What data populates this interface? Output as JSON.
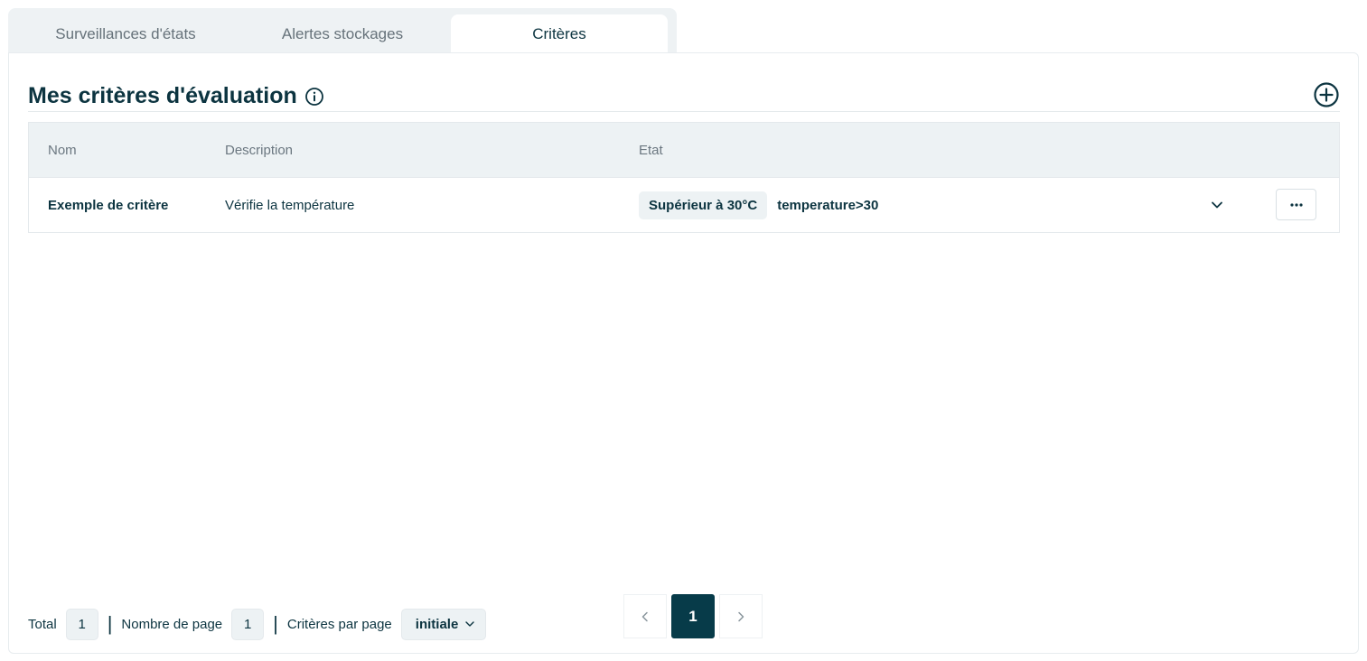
{
  "tabs": [
    {
      "label": "Surveillances d'états",
      "active": false
    },
    {
      "label": "Alertes stockages",
      "active": false
    },
    {
      "label": "Critères",
      "active": true
    }
  ],
  "section": {
    "title": "Mes critères d'évaluation",
    "info_icon": "info-icon",
    "add_icon": "plus-circle-icon"
  },
  "table": {
    "headers": {
      "name": "Nom",
      "description": "Description",
      "state": "Etat"
    },
    "rows": [
      {
        "name": "Exemple de critère",
        "description": "Vérifie la température",
        "state_chip": "Supérieur à 30°C",
        "expression": "temperature>30"
      }
    ]
  },
  "footer": {
    "total_label": "Total",
    "total_value": "1",
    "pages_label": "Nombre de page",
    "pages_value": "1",
    "per_page_label": "Critères par page",
    "per_page_value": "initiale"
  },
  "pagination": {
    "current_page": "1"
  },
  "colors": {
    "primary": "#073b49",
    "text": "#0c3440",
    "muted": "#66727a",
    "surface": "#edf2f4"
  }
}
